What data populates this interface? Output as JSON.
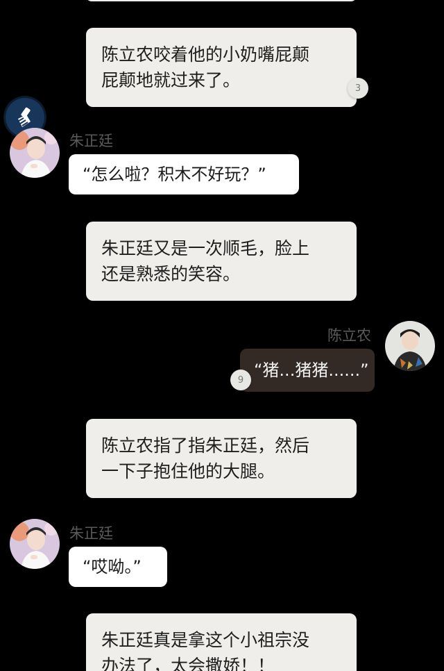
{
  "messages": {
    "m1": "陈立农咬着他的小奶嘴屁颠屁颠地就过来了。",
    "m1_line1": "陈立农咬着他的小奶嘴屁颠",
    "m1_line2": "屁颠地就过来了。",
    "m1_badge": "3",
    "m2_name": "朱正廷",
    "m2_text": "“怎么啦？积木不好玩？”",
    "m3_line1": "朱正廷又是一次顺毛，脸上",
    "m3_line2": "还是熟悉的笑容。",
    "m4_name": "陈立农",
    "m4_text": "“猪...猪猪......”",
    "m4_badge": "9",
    "m5_line1": "陈立农指了指朱正廷，然后",
    "m5_line2": "一下子抱住他的大腿。",
    "m6_name": "朱正廷",
    "m6_text": "“哎呦。”",
    "m7_line1": "朱正廷真是拿这个小祖宗没",
    "m7_line2": "办法了，太会撒娇！！"
  },
  "icons": {
    "brush": "paint-brush-icon",
    "avatar_zhu": "avatar-zhu",
    "avatar_chen": "avatar-chen"
  },
  "colors": {
    "background": "#000000",
    "narration_bubble": "#efeeea",
    "white_bubble": "#ffffff",
    "dark_bubble": "#332925",
    "name_text": "#5a5a5a"
  }
}
